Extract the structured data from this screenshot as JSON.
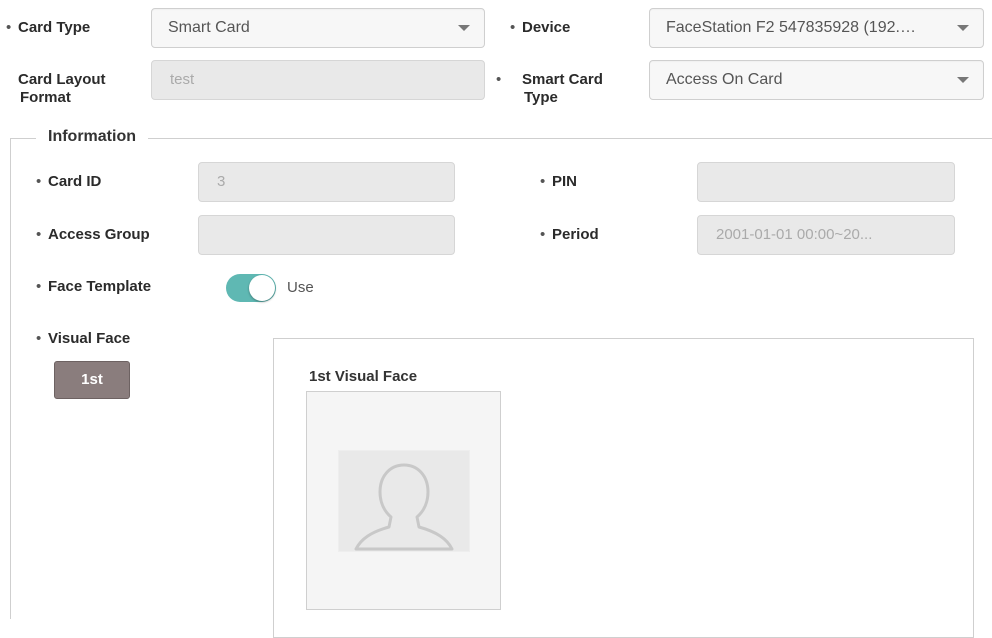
{
  "top": {
    "card_type": {
      "label": "Card Type",
      "value": "Smart Card"
    },
    "device": {
      "label": "Device",
      "value": "FaceStation F2 547835928 (192.…"
    },
    "card_layout_format": {
      "label": "Card Layout Format",
      "value": "test"
    },
    "smart_card_type": {
      "label": "Smart Card Type",
      "value": "Access On Card"
    }
  },
  "information": {
    "legend": "Information",
    "card_id": {
      "label": "Card ID",
      "value": "3"
    },
    "pin": {
      "label": "PIN",
      "value": ""
    },
    "access_group": {
      "label": "Access Group",
      "value": ""
    },
    "period": {
      "label": "Period",
      "value": "2001-01-01 00:00~20..."
    },
    "face_template": {
      "label": "Face Template",
      "toggle_text": "Use",
      "enabled": true
    },
    "visual_face": {
      "label": "Visual Face",
      "tab": "1st",
      "panel_title": "1st Visual Face"
    }
  },
  "colors": {
    "toggle_on": "#5fb8b3",
    "tab_button": "#8a7d7d"
  },
  "icons": {
    "face_placeholder": "person-silhouette-icon"
  }
}
